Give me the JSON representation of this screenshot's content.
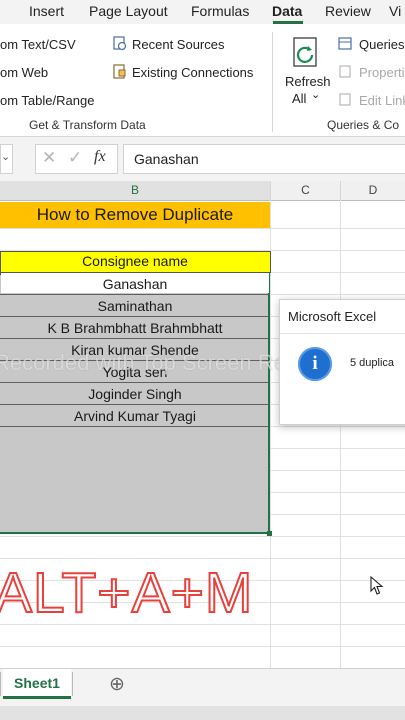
{
  "ribbon_tabs": [
    "Insert",
    "Page Layout",
    "Formulas",
    "Data",
    "Review",
    "Vi"
  ],
  "ribbon": {
    "get_transform": {
      "items": [
        "om Text/CSV",
        "om Web",
        "om Table/Range"
      ],
      "recent_sources": "Recent Sources",
      "existing_connections": "Existing Connections",
      "group_label": "Get & Transform Data"
    },
    "queries": {
      "refresh_line1": "Refresh",
      "refresh_line2": "All",
      "refresh_caret": "⌄",
      "queries_label": "Queries",
      "properties_label": "Properti",
      "edit_links_label": "Edit Link",
      "group_label": "Queries & Co"
    }
  },
  "formula_bar": {
    "cancel_glyph": "✕",
    "enter_glyph": "✓",
    "fx_glyph": "fx",
    "content": "Ganashan"
  },
  "columns": [
    "B",
    "C",
    "D"
  ],
  "sheet": {
    "title": "How to Remove Duplicate",
    "header": "Consignee name",
    "rows": [
      "Ganashan",
      "Saminathan",
      "K B Brahmbhatt Brahmbhatt",
      "Kiran kumar Shende",
      "Yogita sen",
      "Joginder Singh",
      "Arvind Kumar Tyagi"
    ]
  },
  "overlay": {
    "watermark": "Recorded with Top Screen Recorder",
    "shortcut": "ALT+A+M"
  },
  "dialog": {
    "title": "Microsoft Excel",
    "message": "5 duplica",
    "info_glyph": "i"
  },
  "sheet_tabs": {
    "active": "Sheet1",
    "add_glyph": "⊕"
  },
  "colors": {
    "title_fill": "#ffc000",
    "header_fill": "#ffff00",
    "selection_fill": "#c8c8c8",
    "accent": "#217346",
    "overlay_red": "#e8413c"
  }
}
